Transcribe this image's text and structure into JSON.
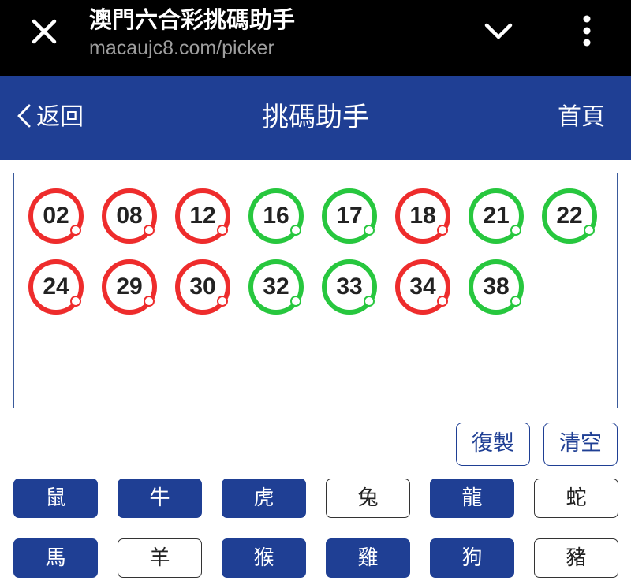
{
  "browser": {
    "title": "澳門六合彩挑碼助手",
    "url": "macaujc8.com/picker",
    "close_icon": "close-icon",
    "chevron_icon": "chevron-down-icon",
    "menu_icon": "more-vert-icon"
  },
  "header": {
    "back_label": "返回",
    "back_icon": "chevron-left-icon",
    "title": "挑碼助手",
    "home_label": "首頁",
    "color": "#1f3f94"
  },
  "colors": {
    "red": "#ee2c2c",
    "green": "#27c73e",
    "accent": "#1f3f94"
  },
  "picked_numbers": [
    {
      "number": "02",
      "color": "red"
    },
    {
      "number": "08",
      "color": "red"
    },
    {
      "number": "12",
      "color": "red"
    },
    {
      "number": "16",
      "color": "green"
    },
    {
      "number": "17",
      "color": "green"
    },
    {
      "number": "18",
      "color": "red"
    },
    {
      "number": "21",
      "color": "green"
    },
    {
      "number": "22",
      "color": "green"
    },
    {
      "number": "24",
      "color": "red"
    },
    {
      "number": "29",
      "color": "red"
    },
    {
      "number": "30",
      "color": "red"
    },
    {
      "number": "32",
      "color": "green"
    },
    {
      "number": "33",
      "color": "green"
    },
    {
      "number": "34",
      "color": "red"
    },
    {
      "number": "38",
      "color": "green"
    }
  ],
  "actions": {
    "copy_label": "復製",
    "clear_label": "清空"
  },
  "zodiacs": [
    {
      "name": "鼠",
      "selected": true
    },
    {
      "name": "牛",
      "selected": true
    },
    {
      "name": "虎",
      "selected": true
    },
    {
      "name": "兔",
      "selected": false
    },
    {
      "name": "龍",
      "selected": true
    },
    {
      "name": "蛇",
      "selected": false
    },
    {
      "name": "馬",
      "selected": true
    },
    {
      "name": "羊",
      "selected": false
    },
    {
      "name": "猴",
      "selected": true
    },
    {
      "name": "雞",
      "selected": true
    },
    {
      "name": "狗",
      "selected": true
    },
    {
      "name": "豬",
      "selected": false
    }
  ]
}
